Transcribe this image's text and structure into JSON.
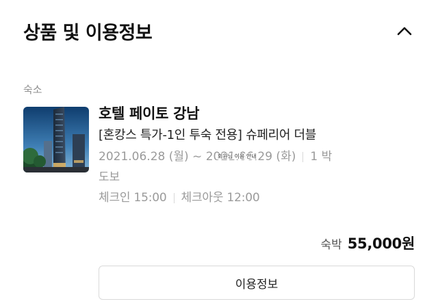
{
  "section": {
    "title": "상품 및 이용정보",
    "toggle_icon": "chevron-up-icon"
  },
  "product": {
    "category": "숙소",
    "hotel_name": "호텔 페이토 강남",
    "room_name": "[혼캉스 특가-1인 투숙 전용] 슈페리어 더블",
    "date_range": "2021.06.28 (월) ~ 2021.06.29 (화)",
    "nights": "1 박",
    "access": "도보",
    "checkin": "체크인 15:00",
    "checkout": "체크아웃 12:00",
    "overlay_note": "회원님 이용 안내"
  },
  "price": {
    "label": "숙박",
    "value": "55,000원"
  },
  "actions": {
    "detail_button_label": "이용정보"
  }
}
